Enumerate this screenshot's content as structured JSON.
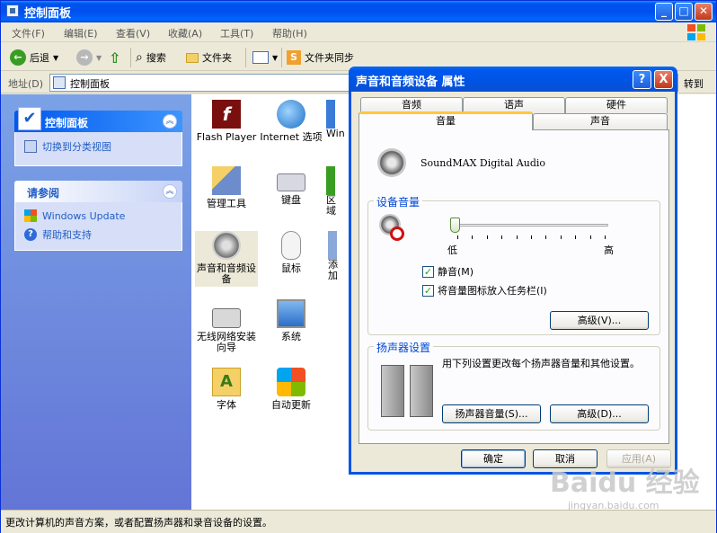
{
  "window": {
    "title": "控制面板"
  },
  "menu": [
    "文件(F)",
    "编辑(E)",
    "查看(V)",
    "收藏(A)",
    "工具(T)",
    "帮助(H)"
  ],
  "toolbar": {
    "back": "后退",
    "search": "搜索",
    "folders": "文件夹",
    "sync": "文件夹同步"
  },
  "address": {
    "label": "地址(D)",
    "value": "控制面板",
    "go": "转到"
  },
  "taskpane": {
    "panel_title": "控制面板",
    "switch_view": "切换到分类视图",
    "see_also_title": "请参阅",
    "windows_update": "Windows Update",
    "help_support": "帮助和支持"
  },
  "items": {
    "flash_player": "Flash Player",
    "internet_options": "Internet 选项",
    "win_partial": "Win",
    "admin_tools": "管理工具",
    "keyboard": "键盘",
    "region_partial": "区域",
    "sound_audio": "声音和音频设备",
    "mouse": "鼠标",
    "add_partial": "添加",
    "wireless_wizard": "无线网络安装向导",
    "system": "系统",
    "fonts": "字体",
    "auto_update": "自动更新"
  },
  "status": "更改计算机的声音方案，或者配置扬声器和录音设备的设置。",
  "dialog": {
    "title": "声音和音频设备  属性",
    "help_btn": "?",
    "close_btn": "X",
    "tabs_row1": [
      "音频",
      "语声",
      "硬件"
    ],
    "tabs_row2": [
      "音量",
      "声音"
    ],
    "device_name": "SoundMAX Digital Audio",
    "device_volume_label": "设备音量",
    "low": "低",
    "high": "高",
    "volume_level": 0,
    "mute_label": "静音(M)",
    "mute_checked": true,
    "tray_label": "将音量图标放入任务栏(I)",
    "tray_checked": true,
    "advanced1": "高级(V)...",
    "speaker_settings_label": "扬声器设置",
    "speaker_desc": "用下列设置更改每个扬声器音量和其他设置。",
    "speaker_volume_btn": "扬声器音量(S)...",
    "advanced2": "高级(D)...",
    "ok": "确定",
    "cancel": "取消",
    "apply": "应用(A)"
  },
  "watermark": {
    "text": "Baidu 经验",
    "sub": "jingyan.baidu.com"
  },
  "colors": {
    "xp_blue": "#0054e3",
    "taskpane_top": "#7ba2e7",
    "group_label": "#0046d5"
  }
}
